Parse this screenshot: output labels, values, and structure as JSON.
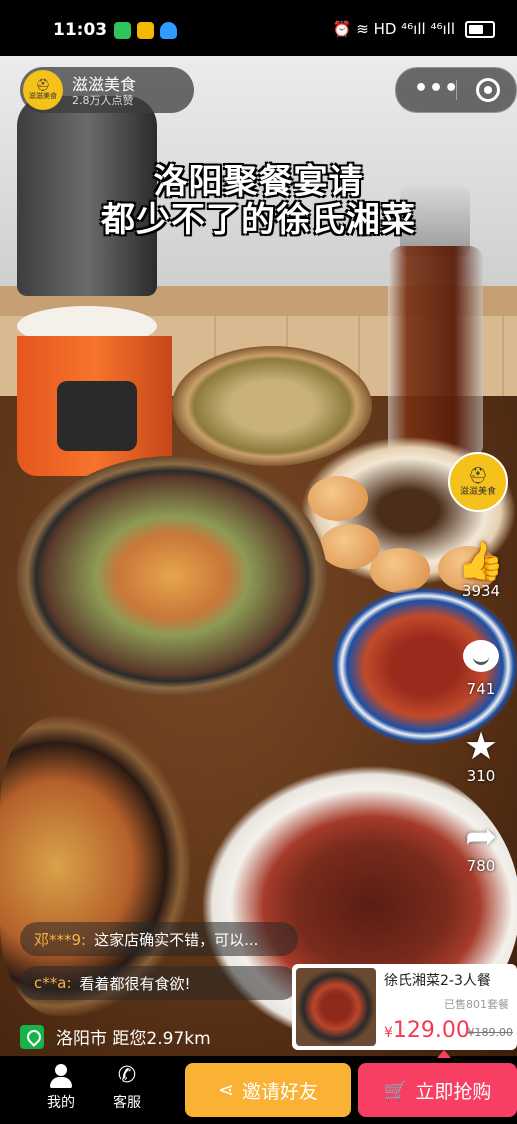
{
  "status_bar": {
    "time": "11:03",
    "notif_colors": [
      "#2ec35b",
      "#f5b800",
      "#2f9bff"
    ],
    "right_text": "⏰ ≋ HD ⁴⁶ıll ⁴⁶ıll"
  },
  "account": {
    "name": "滋滋美食",
    "likes": "2.8万人点赞",
    "logo_text": "滋滋美食"
  },
  "capsule": {
    "more": "•••"
  },
  "video": {
    "caption_line1": "洛阳聚餐宴请",
    "caption_line2": "都少不了的徐氏湘菜"
  },
  "actions": {
    "like_count": "3934",
    "comment_count": "741",
    "favorite_count": "310",
    "share_count": "780"
  },
  "comments": [
    {
      "user": "邓***9:",
      "text": "这家店确实不错，可以..."
    },
    {
      "user": "c**a:",
      "text": "看着都很有食欲!"
    }
  ],
  "location": {
    "text": "洛阳市 距您2.97km"
  },
  "product": {
    "name": "徐氏湘菜2-3人餐",
    "sold": "已售801套餐",
    "currency": "¥",
    "price": "129.00",
    "original_price": "¥189.00"
  },
  "bottom_bar": {
    "me_label": "我的",
    "service_label": "客服",
    "invite_label": "邀请好友",
    "buy_label": "立即抢购"
  },
  "colors": {
    "accent_yellow": "#f9b233",
    "accent_pink": "#f73e63",
    "location_green": "#18b24b",
    "price_red": "#f23a52"
  }
}
